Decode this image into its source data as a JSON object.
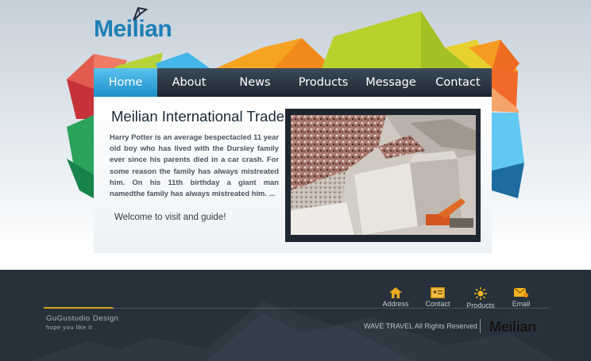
{
  "brand": {
    "logo_text": "Meilian"
  },
  "nav": {
    "items": [
      {
        "label": "Home",
        "active": true
      },
      {
        "label": "About"
      },
      {
        "label": "News"
      },
      {
        "label": "Products"
      },
      {
        "label": "Message"
      },
      {
        "label": "Contact"
      }
    ]
  },
  "main": {
    "title": "Meilian International Trade",
    "description": "Harry Potter is an average bespectacled 11 year old boy who has lived with the Dursley family ever since his parents died in a car crash. For some reason the family has always mistreated him. On his 11th birthday a giant man namedthe family has always mistreated him. ...",
    "welcome": "Welcome to visit and guide!"
  },
  "footer": {
    "studio": "GuGustudio Design",
    "tagline": "hope you like it",
    "links": [
      {
        "label": "Address",
        "icon": "home-icon"
      },
      {
        "label": "Contact",
        "icon": "contact-card-icon"
      },
      {
        "label": "Products",
        "icon": "sun-icon"
      },
      {
        "label": "Email",
        "icon": "email-icon"
      }
    ],
    "copyright": "WAVE TRAVEL All Rights Reserved",
    "logo_text": "Meilian"
  },
  "colors": {
    "accent": "#1d8fc8",
    "gold": "#d8a21b",
    "footer_bg": "#27313b"
  }
}
